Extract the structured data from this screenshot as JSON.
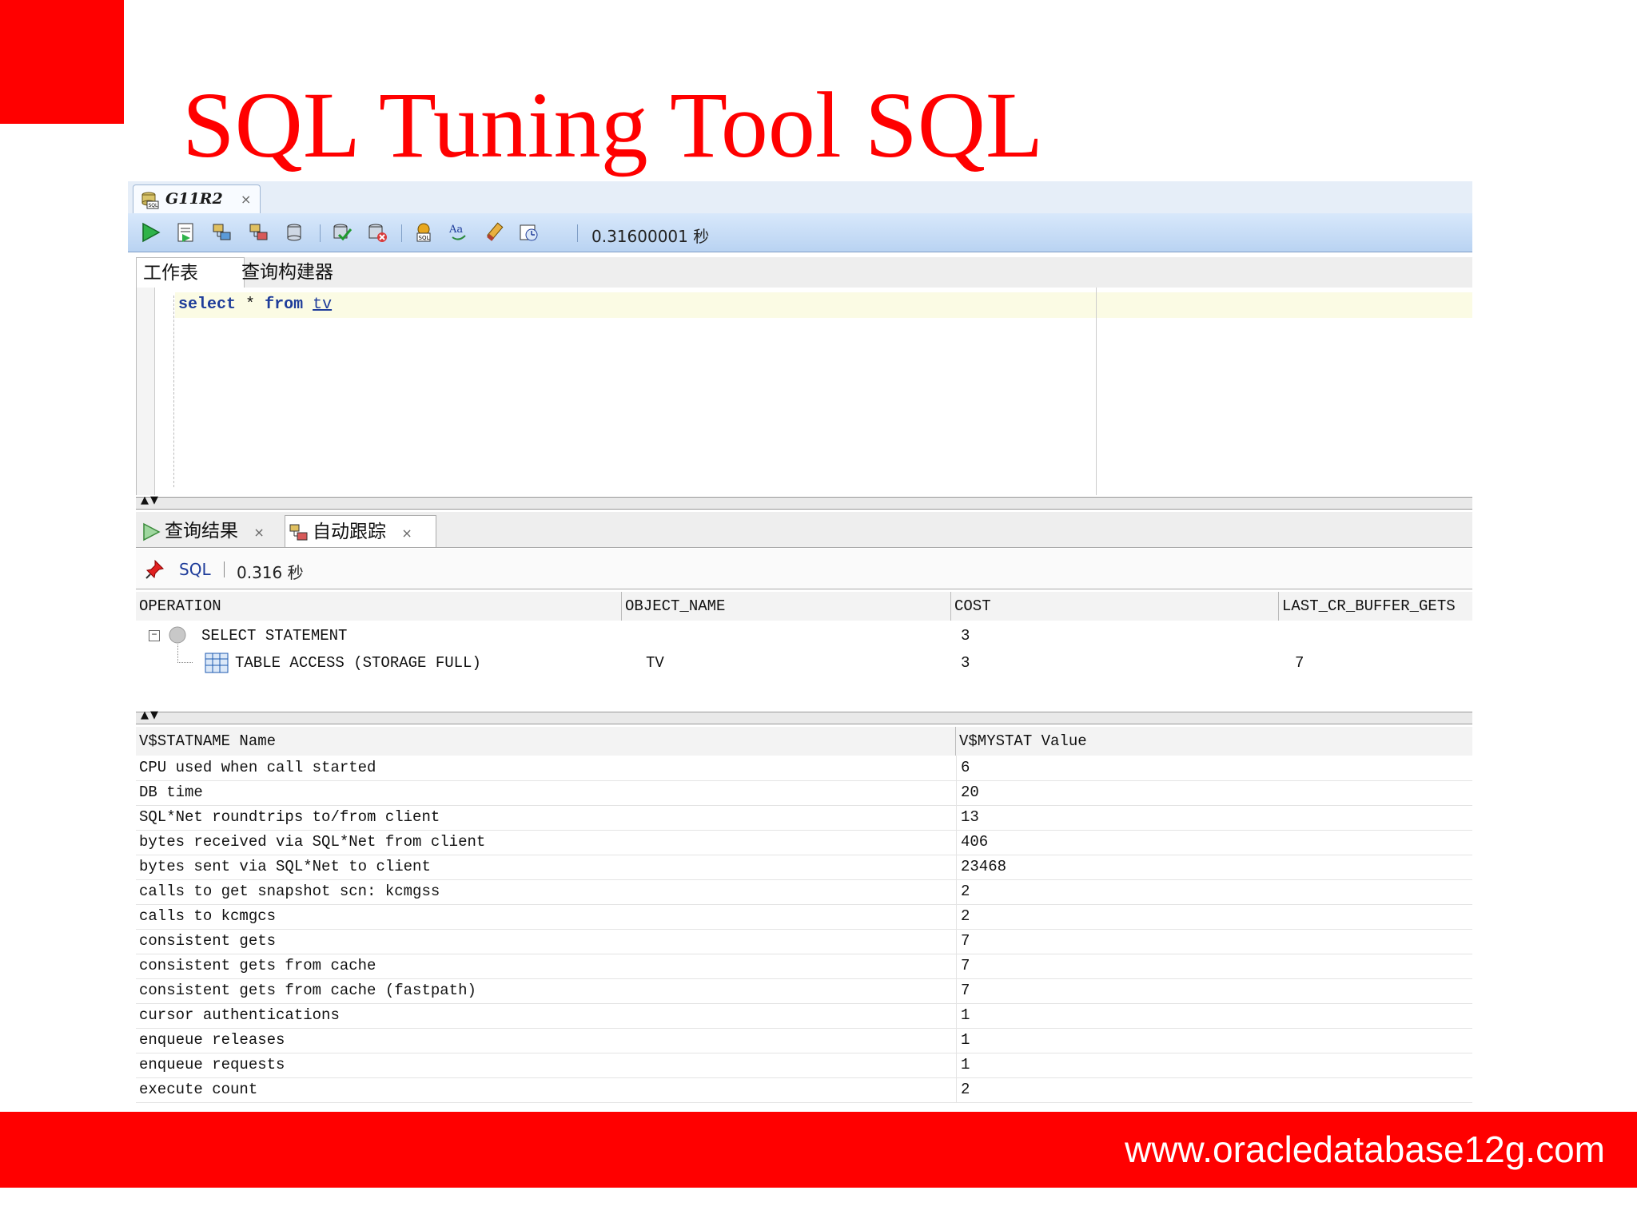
{
  "slide": {
    "title": "SQL Tuning Tool SQL",
    "footer_url": "www.oracledatabase12g.com",
    "colors": {
      "accent": "#ff0000",
      "footer_text": "#ffffff"
    }
  },
  "connection_tab": {
    "label": "G11R2",
    "close": "×",
    "icon": "database-sql-icon"
  },
  "toolbar": {
    "buttons": [
      "run-statement-icon",
      "run-script-icon",
      "explain-plan-icon",
      "autotrace-icon",
      "commit-icon",
      "rollback-icon",
      "unshared-sql-icon",
      "sql-tuning-advisor-icon",
      "format-icon",
      "clear-icon",
      "history-icon"
    ],
    "elapsed": "0.31600001 秒"
  },
  "editor_tabs": [
    "工作表",
    "查询构建器"
  ],
  "editor": {
    "keyword_select": "select",
    "star": "*",
    "keyword_from": "from",
    "table": "tv"
  },
  "result_tabs": [
    {
      "label": "查询结果",
      "close": "×"
    },
    {
      "label": "自动跟踪",
      "close": "×"
    }
  ],
  "trace_bar": {
    "sql_link": "SQL",
    "elapsed": "0.316 秒"
  },
  "plan": {
    "columns": [
      "OPERATION",
      "OBJECT_NAME",
      "COST",
      "LAST_CR_BUFFER_GETS"
    ],
    "rows": [
      {
        "operation": "SELECT STATEMENT",
        "object_name": "",
        "cost": "3",
        "last_cr_buffer_gets": ""
      },
      {
        "operation": "TABLE ACCESS (STORAGE FULL)",
        "object_name": "TV",
        "cost": "3",
        "last_cr_buffer_gets": "7"
      }
    ]
  },
  "stats": {
    "columns": [
      "V$STATNAME Name",
      "V$MYSTAT Value"
    ],
    "rows": [
      {
        "name": "CPU used when call started",
        "value": "6"
      },
      {
        "name": "DB time",
        "value": "20"
      },
      {
        "name": "SQL*Net roundtrips to/from client",
        "value": "13"
      },
      {
        "name": "bytes received via SQL*Net from client",
        "value": "406"
      },
      {
        "name": "bytes sent via SQL*Net to client",
        "value": "23468"
      },
      {
        "name": "calls to get snapshot scn: kcmgss",
        "value": "2"
      },
      {
        "name": "calls to kcmgcs",
        "value": "2"
      },
      {
        "name": "consistent gets",
        "value": "7"
      },
      {
        "name": "consistent gets from cache",
        "value": "7"
      },
      {
        "name": "consistent gets from cache (fastpath)",
        "value": "7"
      },
      {
        "name": "cursor authentications",
        "value": "1"
      },
      {
        "name": "enqueue releases",
        "value": "1"
      },
      {
        "name": "enqueue requests",
        "value": "1"
      },
      {
        "name": "execute count",
        "value": "2"
      }
    ]
  }
}
